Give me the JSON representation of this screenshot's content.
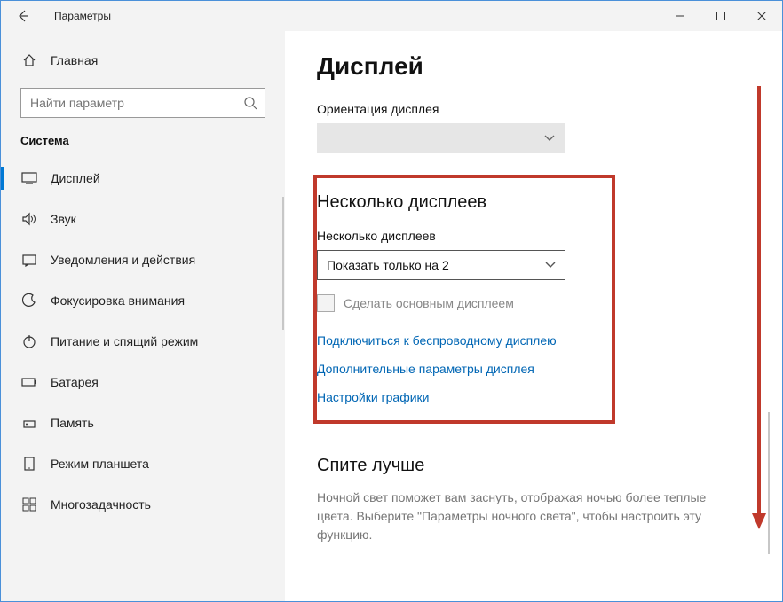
{
  "window": {
    "title": "Параметры"
  },
  "sidebar": {
    "home_label": "Главная",
    "search_placeholder": "Найти параметр",
    "category": "Система",
    "items": [
      {
        "label": "Дисплей"
      },
      {
        "label": "Звук"
      },
      {
        "label": "Уведомления и действия"
      },
      {
        "label": "Фокусировка внимания"
      },
      {
        "label": "Питание и спящий режим"
      },
      {
        "label": "Батарея"
      },
      {
        "label": "Память"
      },
      {
        "label": "Режим планшета"
      },
      {
        "label": "Многозадачность"
      }
    ]
  },
  "main": {
    "page_title": "Дисплей",
    "orientation_label": "Ориентация дисплея",
    "multi_display": {
      "title": "Несколько дисплеев",
      "label": "Несколько дисплеев",
      "value": "Показать только на 2",
      "checkbox_label": "Сделать основным дисплеем",
      "link_wireless": "Подключиться к беспроводному дисплею",
      "link_advanced": "Дополнительные параметры дисплея",
      "link_graphics": "Настройки графики"
    },
    "sleep": {
      "title": "Спите лучше",
      "desc": "Ночной свет поможет вам заснуть, отображая ночью более теплые цвета. Выберите \"Параметры ночного света\", чтобы настроить эту функцию."
    }
  }
}
